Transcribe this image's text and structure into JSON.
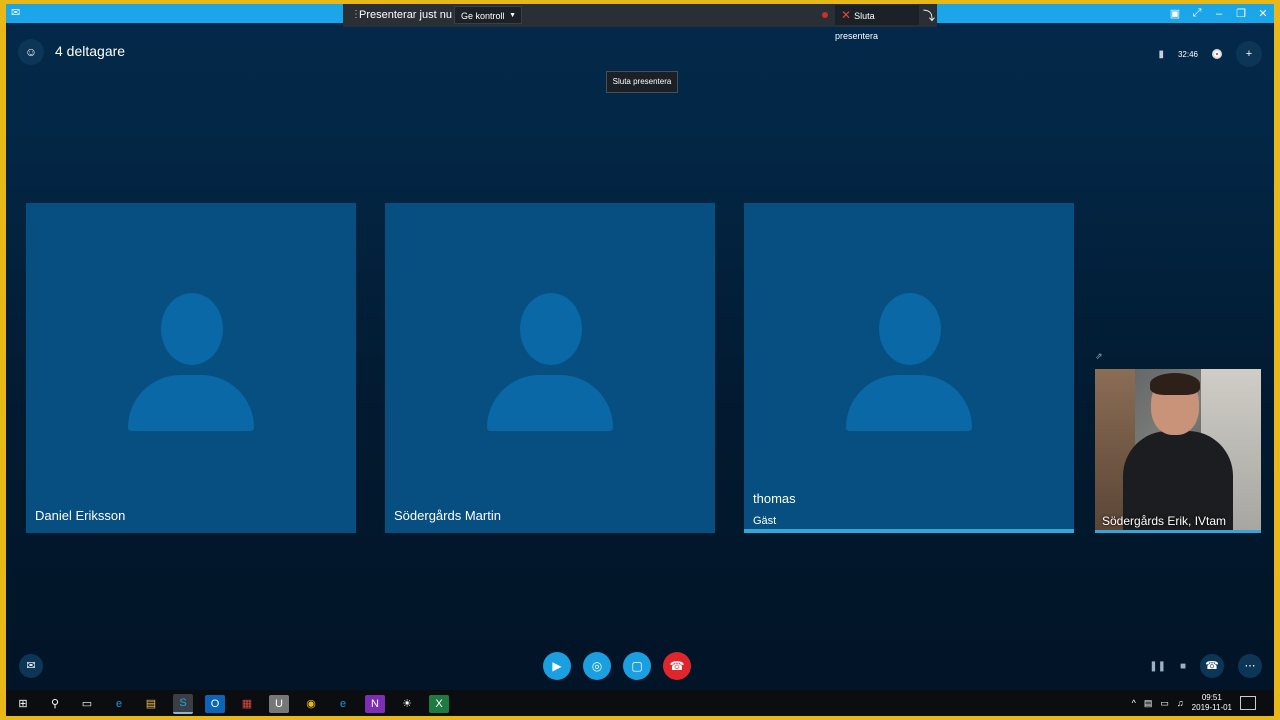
{
  "titlebar": {
    "app_icon": "skype-chat-icon",
    "window_controls": [
      "layout-icon",
      "fullscreen-icon",
      "minimize-icon",
      "restore-icon",
      "close-icon"
    ]
  },
  "presenting_bar": {
    "status": "Presenterar just nu",
    "give_control": "Ge kontroll",
    "stop_presenting": "Sluta presentera"
  },
  "tooltip": "Sluta presentera",
  "header": {
    "participant_count": "4 deltagare",
    "call_duration": "32:46"
  },
  "participants": [
    {
      "name": "Daniel Eriksson",
      "subtitle": ""
    },
    {
      "name": "Södergårds Martin",
      "subtitle": ""
    },
    {
      "name": "thomas",
      "subtitle": "Gäst"
    }
  ],
  "self_view": {
    "name": "Södergårds Erik, IVtam"
  },
  "controls": {
    "video": "video-camera-icon",
    "mic": "microphone-icon",
    "share": "present-screen-icon",
    "hangup": "hang-up-icon"
  },
  "taskbar": {
    "clock_time": "09:51",
    "clock_date": "2019-11-01"
  },
  "colors": {
    "frame_border": "#e8b818",
    "titlebar": "#1aa6e8",
    "tile": "#064f80",
    "hangup": "#e0262d",
    "accent_blue": "#1a9fe0"
  }
}
